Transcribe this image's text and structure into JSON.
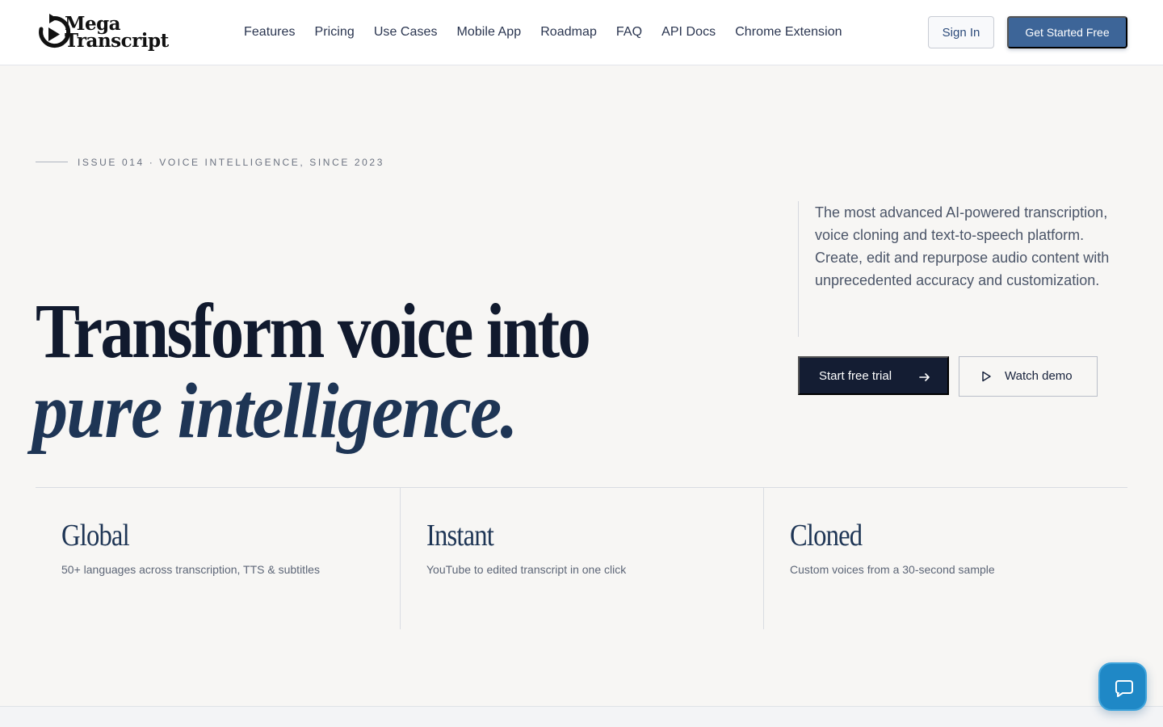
{
  "brand": {
    "name_line1": "Mega",
    "name_line2": "Transcript"
  },
  "nav": {
    "items": [
      {
        "label": "Features"
      },
      {
        "label": "Pricing"
      },
      {
        "label": "Use Cases"
      },
      {
        "label": "Mobile App"
      },
      {
        "label": "Roadmap"
      },
      {
        "label": "FAQ"
      },
      {
        "label": "API Docs"
      },
      {
        "label": "Chrome Extension"
      }
    ],
    "sign_in_label": "Sign In",
    "get_started_label": "Get Started Free"
  },
  "hero": {
    "eyebrow": "ISSUE 014 · VOICE INTELLIGENCE, SINCE 2023",
    "headline_line1": "Transform voice into",
    "headline_line2": "pure intelligence.",
    "description": "The most advanced AI-powered transcription, voice cloning and text-to-speech platform. Create, edit and repurpose audio content with unprecedented accuracy and customization.",
    "primary_cta": "Start free trial",
    "secondary_cta": "Watch demo"
  },
  "stats": [
    {
      "title": "Global",
      "description": "50+ languages across transcription, TTS & subtitles"
    },
    {
      "title": "Instant",
      "description": "YouTube to edited transcript in one click"
    },
    {
      "title": "Cloned",
      "description": "Custom voices from a 30-second sample"
    }
  ],
  "colors": {
    "primary_button": "#3d6598",
    "dark_button": "#141d33",
    "headline_accent": "#1e3555",
    "chat_button": "#1f88c6",
    "background": "#f7f6f4"
  },
  "icons": {
    "logo": "play-refresh-icon",
    "trial_arrow": "arrow-right-icon",
    "demo": "play-icon",
    "chat": "chat-bubble-icon"
  }
}
